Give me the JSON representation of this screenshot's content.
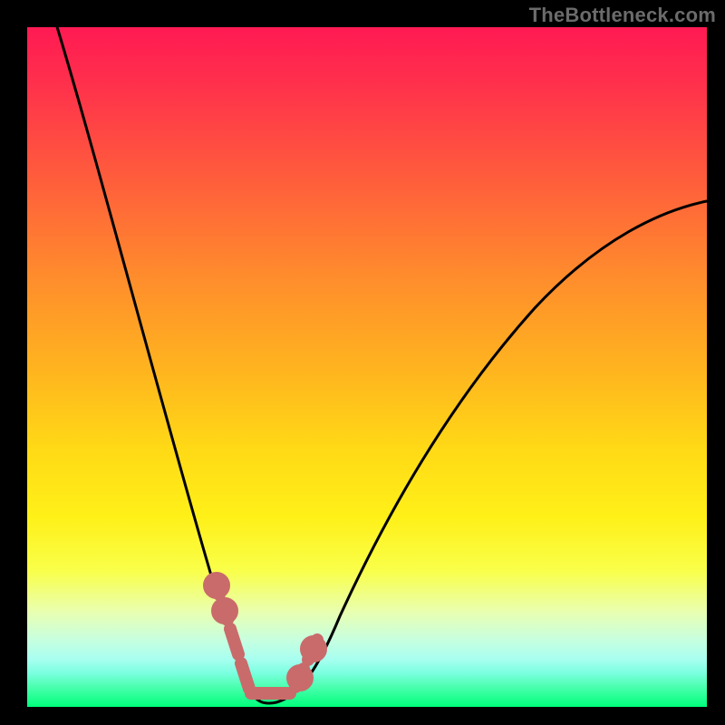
{
  "watermark": {
    "text": "TheBottleneck.com"
  },
  "colors": {
    "frame": "#000000",
    "curve": "#000000",
    "segment_marker": "#c96b6b",
    "gradient_stops": [
      "#ff1a53",
      "#ff2f4c",
      "#ff5c3c",
      "#ff8a2d",
      "#ffb31f",
      "#ffd916",
      "#fff018",
      "#f9ff4a",
      "#e9ffb0",
      "#c8ffde",
      "#a8fff0",
      "#7bffe0",
      "#4cffb0",
      "#00ff7a"
    ]
  },
  "chart_data": {
    "type": "line",
    "title": "",
    "xlabel": "",
    "ylabel": "",
    "xlim": [
      0,
      100
    ],
    "ylim": [
      0,
      100
    ],
    "note": "V-shaped bottleneck curve on vertical performance gradient; vertex at approximately x≈33.",
    "series": [
      {
        "name": "bottleneck-curve-left",
        "x": [
          0,
          4,
          8,
          12,
          16,
          20,
          24,
          26,
          28,
          30,
          32,
          33
        ],
        "y": [
          100,
          90,
          78,
          65,
          52,
          40,
          28,
          22,
          16,
          10,
          4,
          1
        ]
      },
      {
        "name": "bottleneck-curve-right",
        "x": [
          33,
          36,
          40,
          46,
          54,
          62,
          70,
          78,
          86,
          94,
          100
        ],
        "y": [
          1,
          4,
          10,
          20,
          32,
          44,
          54,
          62,
          68,
          72,
          74
        ]
      },
      {
        "name": "highlighted-segment",
        "x": [
          27,
          28,
          30,
          32,
          33,
          34,
          36,
          38,
          40,
          41
        ],
        "y": [
          19,
          16,
          10,
          4,
          1,
          2,
          4,
          8,
          10,
          13
        ]
      }
    ]
  }
}
